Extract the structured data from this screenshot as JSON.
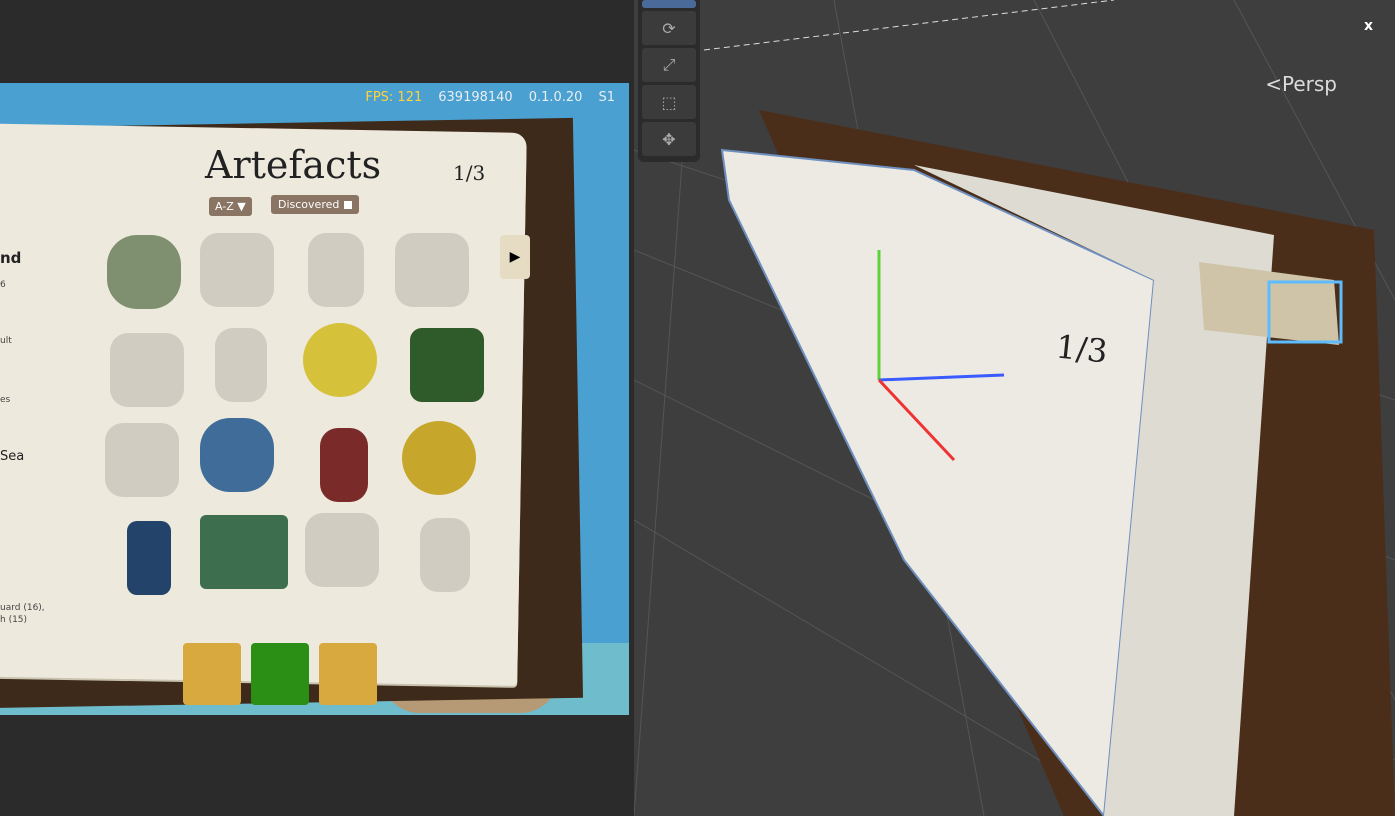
{
  "game": {
    "hud": {
      "fps": "FPS: 121",
      "build_id": "639198140",
      "version": "0.1.0.20",
      "slot": "S1"
    },
    "book": {
      "title": "Artefacts",
      "page_number": "1/3",
      "sort_label": "A-Z ▼",
      "filter_label": "Discovered",
      "left_page_fragments": [
        "nd",
        "6",
        "ult",
        "es",
        "Sea",
        "uard (16),",
        "h (15)"
      ]
    }
  },
  "scene": {
    "persp_label": "<Persp",
    "axis_label": "x",
    "page_number": "1/3",
    "tools": [
      "move",
      "rotate",
      "scale",
      "rect",
      "transform"
    ]
  },
  "colors": {
    "book_page": "#ede9dd",
    "book_leather": "#3d2a1a",
    "accent_ui": "#8a7463",
    "fps_yellow": "#ffd23a"
  }
}
